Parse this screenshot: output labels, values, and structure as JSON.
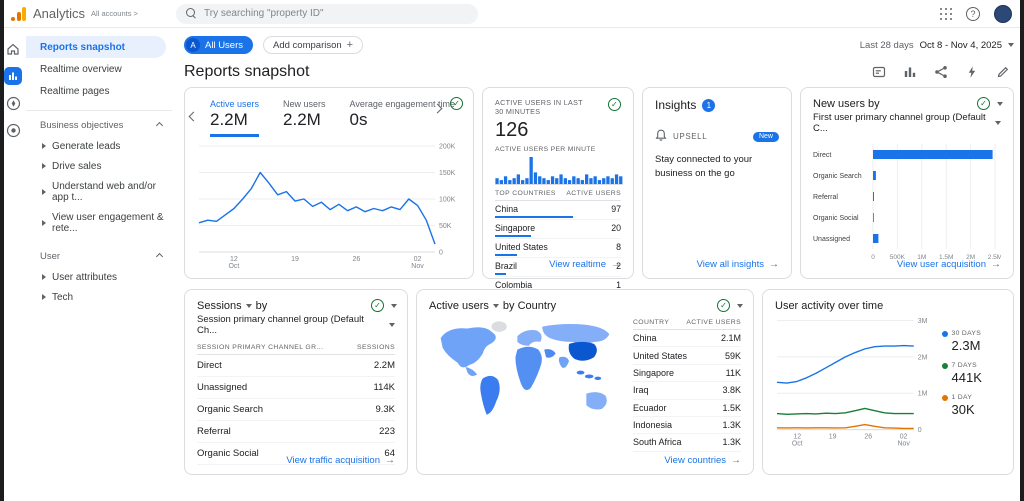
{
  "colors": {
    "accent": "#1a73e8",
    "positive": "#137333",
    "logo_orange": "#f9ab00",
    "logo_dark_orange": "#e37400"
  },
  "topbar": {
    "brand": "Analytics",
    "breadcrumb": "All accounts >",
    "search_placeholder": "Try searching \"property ID\""
  },
  "sidebar": {
    "nav": [
      {
        "label": "Reports snapshot"
      },
      {
        "label": "Realtime overview"
      },
      {
        "label": "Realtime pages"
      }
    ],
    "sections": [
      {
        "title": "Business objectives",
        "items": [
          "Generate leads",
          "Drive sales",
          "Understand web and/or app t...",
          "View user engagement & rete..."
        ]
      },
      {
        "title": "User",
        "items": [
          "User attributes",
          "Tech"
        ]
      }
    ]
  },
  "toolbar": {
    "all_users_avatar": "A",
    "all_users_label": "All Users",
    "add_comparison_label": "Add comparison",
    "date_range_label": "Last 28 days",
    "date_range_value": "Oct 8 - Nov 4, 2025"
  },
  "page": {
    "title": "Reports snapshot"
  },
  "cards": {
    "overview": {
      "tabs": [
        {
          "label": "Active users",
          "value": "2.2M"
        },
        {
          "label": "New users",
          "value": "2.2M"
        },
        {
          "label": "Average engagement time",
          "value": "0s"
        }
      ]
    },
    "realtime": {
      "title": "ACTIVE USERS IN LAST 30 MINUTES",
      "count": "126",
      "subtitle": "ACTIVE USERS PER MINUTE",
      "table_headers": [
        "TOP COUNTRIES",
        "ACTIVE USERS"
      ],
      "rows": [
        {
          "name": "China",
          "value": "97",
          "pct": 100
        },
        {
          "name": "Singapore",
          "value": "20",
          "pct": 46
        },
        {
          "name": "United States",
          "value": "8",
          "pct": 28
        },
        {
          "name": "Brazil",
          "value": "2",
          "pct": 14
        },
        {
          "name": "Colombia",
          "value": "1",
          "pct": 8
        }
      ],
      "link": "View realtime"
    },
    "insights": {
      "title": "Insights",
      "badge": "1",
      "item_label": "UPSELL",
      "item_badge": "New",
      "item_text": "Stay connected to your business on the go",
      "link": "View all insights"
    },
    "new_users": {
      "title_line1": "New users by",
      "title_line2": "First user primary channel group (Default C...",
      "link": "View user acquisition"
    },
    "sessions": {
      "title_line1": "Sessions",
      "title_by": "by",
      "title_line2": "Session primary channel group (Default Ch...",
      "table_headers": [
        "SESSION PRIMARY CHANNEL GR...",
        "SESSIONS"
      ],
      "rows": [
        {
          "name": "Direct",
          "value": "2.2M"
        },
        {
          "name": "Unassigned",
          "value": "114K"
        },
        {
          "name": "Organic Search",
          "value": "9.3K"
        },
        {
          "name": "Referral",
          "value": "223"
        },
        {
          "name": "Organic Social",
          "value": "64"
        }
      ],
      "link": "View traffic acquisition"
    },
    "countries": {
      "title_line1": "Active users",
      "title_by": "by Country",
      "table_headers": [
        "COUNTRY",
        "ACTIVE USERS"
      ],
      "rows": [
        {
          "name": "China",
          "value": "2.1M"
        },
        {
          "name": "United States",
          "value": "59K"
        },
        {
          "name": "Singapore",
          "value": "11K"
        },
        {
          "name": "Iraq",
          "value": "3.8K"
        },
        {
          "name": "Ecuador",
          "value": "1.5K"
        },
        {
          "name": "Indonesia",
          "value": "1.3K"
        },
        {
          "name": "South Africa",
          "value": "1.3K"
        }
      ],
      "link": "View countries"
    },
    "activity": {
      "title": "User activity over time",
      "legend": [
        {
          "label": "30 DAYS",
          "value": "2.3M",
          "color": "#1a73e8"
        },
        {
          "label": "7 DAYS",
          "value": "441K",
          "color": "#188038"
        },
        {
          "label": "1 DAY",
          "value": "30K",
          "color": "#e37400"
        }
      ]
    }
  },
  "chart_data": [
    {
      "id": "overview-trend",
      "type": "line",
      "title": "Active users trend",
      "ylim": [
        0,
        200000
      ],
      "y_ticks": [
        {
          "label": "200K",
          "value": 200000
        },
        {
          "label": "150K",
          "value": 150000
        },
        {
          "label": "100K",
          "value": 100000
        },
        {
          "label": "50K",
          "value": 50000
        },
        {
          "label": "0",
          "value": 0
        }
      ],
      "x_ticks": [
        {
          "label": "12",
          "sub": "Oct",
          "frac": 0.148
        },
        {
          "label": "19",
          "frac": 0.407
        },
        {
          "label": "26",
          "frac": 0.667
        },
        {
          "label": "02",
          "sub": "Nov",
          "frac": 0.926
        }
      ],
      "values": [
        55000,
        60000,
        58000,
        70000,
        82000,
        100000,
        120000,
        150000,
        130000,
        108000,
        114000,
        96000,
        100000,
        86000,
        94000,
        80000,
        90000,
        78000,
        85000,
        76000,
        82000,
        78000,
        85000,
        80000,
        100000,
        88000,
        60000,
        15000
      ]
    },
    {
      "id": "realtime-minutes",
      "type": "bar",
      "title": "Active users per minute",
      "values": [
        3,
        2,
        4,
        2,
        3,
        5,
        2,
        3,
        14,
        6,
        4,
        3,
        2,
        4,
        3,
        5,
        3,
        2,
        4,
        3,
        2,
        5,
        3,
        4,
        2,
        3,
        4,
        3,
        5,
        4
      ]
    },
    {
      "id": "new-users-channel",
      "type": "hbar",
      "title": "New users by first user primary channel group",
      "xlim": [
        0,
        2500000
      ],
      "categories": [
        "Direct",
        "Organic Search",
        "Referral",
        "Organic Social",
        "Unassigned"
      ],
      "values": [
        2450000,
        60000,
        20000,
        10000,
        110000
      ],
      "x_ticks": [
        {
          "label": "0",
          "frac": 0
        },
        {
          "label": "500K",
          "frac": 0.2
        },
        {
          "label": "1M",
          "frac": 0.4
        },
        {
          "label": "1.5M",
          "frac": 0.6
        },
        {
          "label": "2M",
          "frac": 0.8
        },
        {
          "label": "2.5M",
          "frac": 1
        }
      ]
    },
    {
      "id": "user-activity",
      "type": "line",
      "title": "User activity over time",
      "ylim": [
        0,
        3000000
      ],
      "y_ticks": [
        {
          "label": "3M",
          "value": 3000000
        },
        {
          "label": "2M",
          "value": 2000000
        },
        {
          "label": "1M",
          "value": 1000000
        },
        {
          "label": "0",
          "value": 0
        }
      ],
      "x_ticks": [
        {
          "label": "12",
          "sub": "Oct",
          "frac": 0.148
        },
        {
          "label": "19",
          "frac": 0.407
        },
        {
          "label": "26",
          "frac": 0.667
        },
        {
          "label": "02",
          "sub": "Nov",
          "frac": 0.926
        }
      ],
      "series": [
        {
          "name": "30 DAYS",
          "color": "#1a73e8",
          "values": [
            1300000,
            1280000,
            1320000,
            1420000,
            1550000,
            1700000,
            1850000,
            2000000,
            2120000,
            2220000,
            2280000,
            2300000,
            2300000,
            2310000,
            2300000
          ]
        },
        {
          "name": "7 DAYS",
          "color": "#188038",
          "values": [
            440000,
            420000,
            430000,
            440000,
            430000,
            450000,
            440000,
            460000,
            520000,
            580000,
            520000,
            460000,
            440000,
            440000,
            441000
          ]
        },
        {
          "name": "1 DAY",
          "color": "#e37400",
          "values": [
            50000,
            45000,
            50000,
            45000,
            50000,
            50000,
            45000,
            50000,
            90000,
            140000,
            90000,
            50000,
            40000,
            30000,
            30000
          ]
        }
      ]
    }
  ]
}
